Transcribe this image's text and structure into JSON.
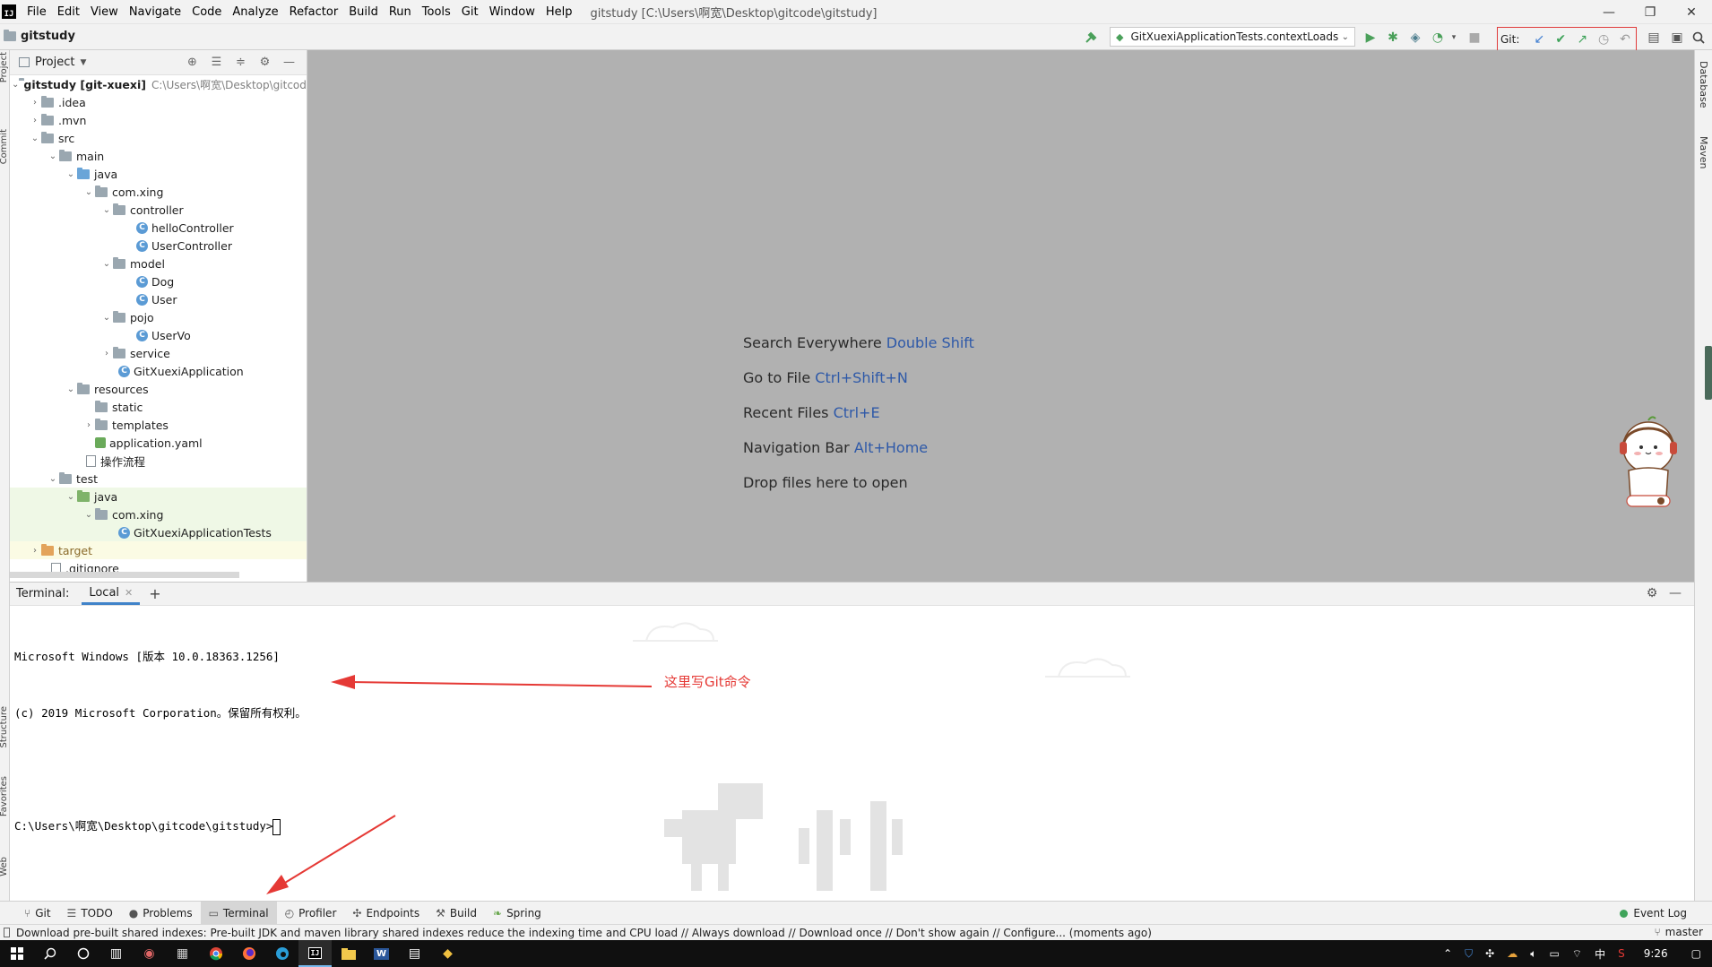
{
  "menu": {
    "app_icon": "IJ",
    "items": [
      "File",
      "Edit",
      "View",
      "Navigate",
      "Code",
      "Analyze",
      "Refactor",
      "Build",
      "Run",
      "Tools",
      "Git",
      "Window",
      "Help"
    ],
    "window_title": "gitstudy [C:\\Users\\啊宽\\Desktop\\gitcode\\gitstudy]",
    "min": "—",
    "max": "❐",
    "close": "✕"
  },
  "toolbar": {
    "project_name": "gitstudy",
    "run_config": "GitXuexiApplicationTests.contextLoads",
    "git_label": "Git:"
  },
  "left_strip": {
    "project": "Project",
    "commit": "Commit",
    "structure": "Structure",
    "favorites": "Favorites",
    "web": "Web"
  },
  "right_strip": {
    "database": "Database",
    "maven": "Maven"
  },
  "project_panel": {
    "title": "Project",
    "root_name": "gitstudy [git-xuexi]",
    "root_path": "C:\\Users\\啊宽\\Desktop\\gitcode\\gitstudy",
    "rows": [
      {
        "label": ".idea"
      },
      {
        "label": ".mvn"
      },
      {
        "label": "src"
      },
      {
        "label": "main"
      },
      {
        "label": "java"
      },
      {
        "label": "com.xing"
      },
      {
        "label": "controller"
      },
      {
        "label": "helloController"
      },
      {
        "label": "UserController"
      },
      {
        "label": "model"
      },
      {
        "label": "Dog"
      },
      {
        "label": "User"
      },
      {
        "label": "pojo"
      },
      {
        "label": "UserVo"
      },
      {
        "label": "service"
      },
      {
        "label": "GitXuexiApplication"
      },
      {
        "label": "resources"
      },
      {
        "label": "static"
      },
      {
        "label": "templates"
      },
      {
        "label": "application.yaml"
      },
      {
        "label": "操作流程"
      },
      {
        "label": "test"
      },
      {
        "label": "java"
      },
      {
        "label": "com.xing"
      },
      {
        "label": "GitXuexiApplicationTests"
      },
      {
        "label": "target"
      },
      {
        "label": ".gitignore"
      }
    ]
  },
  "editor_hints": [
    {
      "text": "Search Everywhere ",
      "key": "Double Shift"
    },
    {
      "text": "Go to File ",
      "key": "Ctrl+Shift+N"
    },
    {
      "text": "Recent Files ",
      "key": "Ctrl+E"
    },
    {
      "text": "Navigation Bar ",
      "key": "Alt+Home"
    },
    {
      "text": "Drop files here to open",
      "key": ""
    }
  ],
  "terminal": {
    "label": "Terminal:",
    "tab": "Local",
    "line1": "Microsoft Windows [版本 10.0.18363.1256]",
    "line2": "(c) 2019 Microsoft Corporation。保留所有权利。",
    "prompt": "C:\\Users\\啊宽\\Desktop\\gitcode\\gitstudy>",
    "annotation": "这里写Git命令"
  },
  "tool_tabs": [
    {
      "label": "Git",
      "icon": "branch-icon"
    },
    {
      "label": "TODO",
      "icon": "list-icon"
    },
    {
      "label": "Problems",
      "icon": "problems-icon"
    },
    {
      "label": "Terminal",
      "icon": "terminal-icon"
    },
    {
      "label": "Profiler",
      "icon": "profiler-icon"
    },
    {
      "label": "Endpoints",
      "icon": "endpoints-icon"
    },
    {
      "label": "Build",
      "icon": "hammer-icon"
    },
    {
      "label": "Spring",
      "icon": "spring-icon"
    }
  ],
  "event_log": "Event Log",
  "status": {
    "message": "Download pre-built shared indexes: Pre-built JDK and maven library shared indexes reduce the indexing time and CPU load // Always download // Download once // Don't show again // Configure... (moments ago)",
    "branch": "master"
  },
  "taskbar": {
    "ime": "中",
    "clock": "9:26"
  },
  "colors": {
    "annotation": "#e53935",
    "hint_key": "#2e59a8",
    "editor_bg": "#b1b1b1"
  }
}
